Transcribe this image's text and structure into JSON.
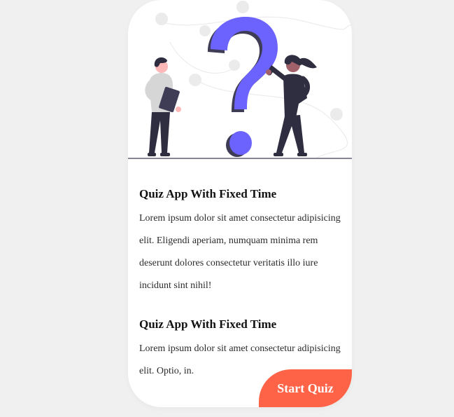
{
  "colors": {
    "page_background": "#f0f0f0",
    "card_background": "#ffffff",
    "accent_question_mark": "#6c63ff",
    "button_background": "#ff6347",
    "button_text": "#ffffff",
    "figure_dark": "#2f2e41"
  },
  "illustration": {
    "icon": "question-mark-people-illustration"
  },
  "sections": [
    {
      "title": "Quiz App With Fixed Time",
      "text": "Lorem ipsum dolor sit amet consectetur adipisicing elit. Eligendi aperiam, numquam minima rem deserunt dolores consectetur veritatis illo iure incidunt sint nihil!"
    },
    {
      "title": "Quiz App With Fixed Time",
      "text": "Lorem ipsum dolor sit amet consectetur adipisicing elit. Optio, in."
    }
  ],
  "start_button": {
    "label": "Start Quiz"
  }
}
